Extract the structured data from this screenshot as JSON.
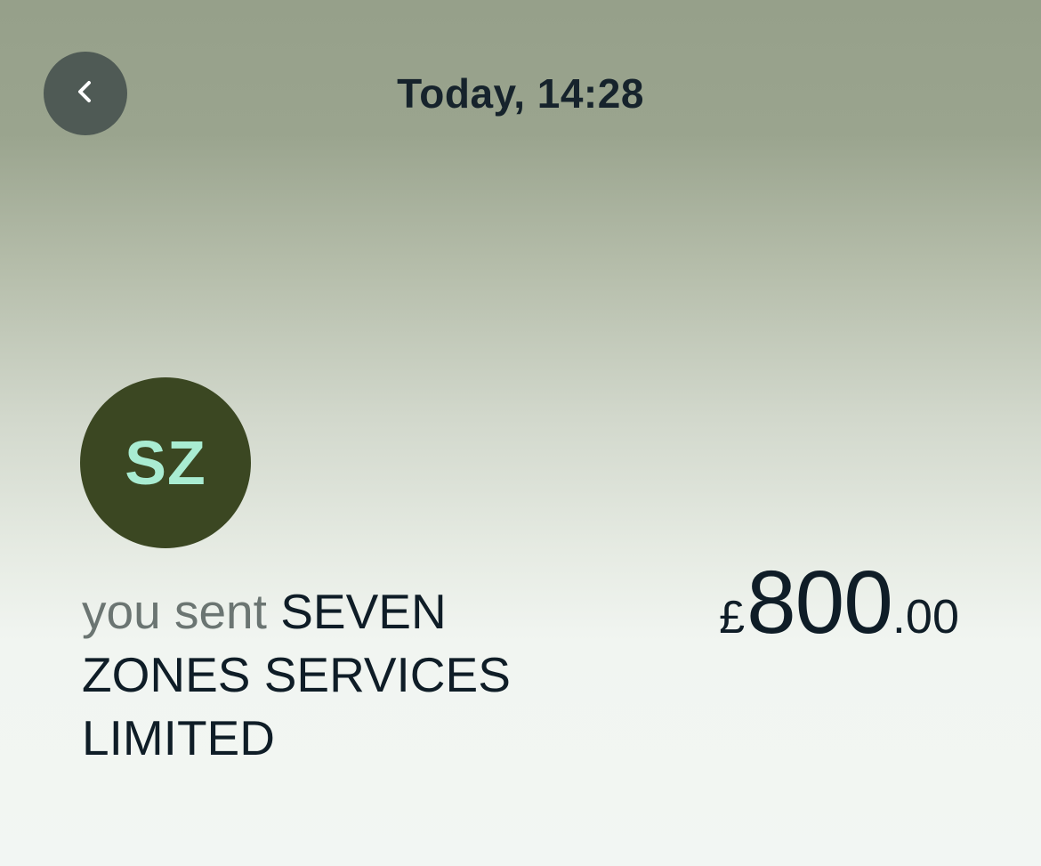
{
  "header": {
    "back_icon": "chevron-left-icon",
    "title": "Today, 14:28"
  },
  "recipient": {
    "initials": "SZ",
    "avatar_color": "#3b4722",
    "initials_color": "#a9ecd2"
  },
  "transaction": {
    "prefix": "you sent",
    "name": "SEVEN ZONES SERVICES LIMITED",
    "amount": {
      "currency": "£",
      "major": "800",
      "minor": ".00"
    }
  }
}
